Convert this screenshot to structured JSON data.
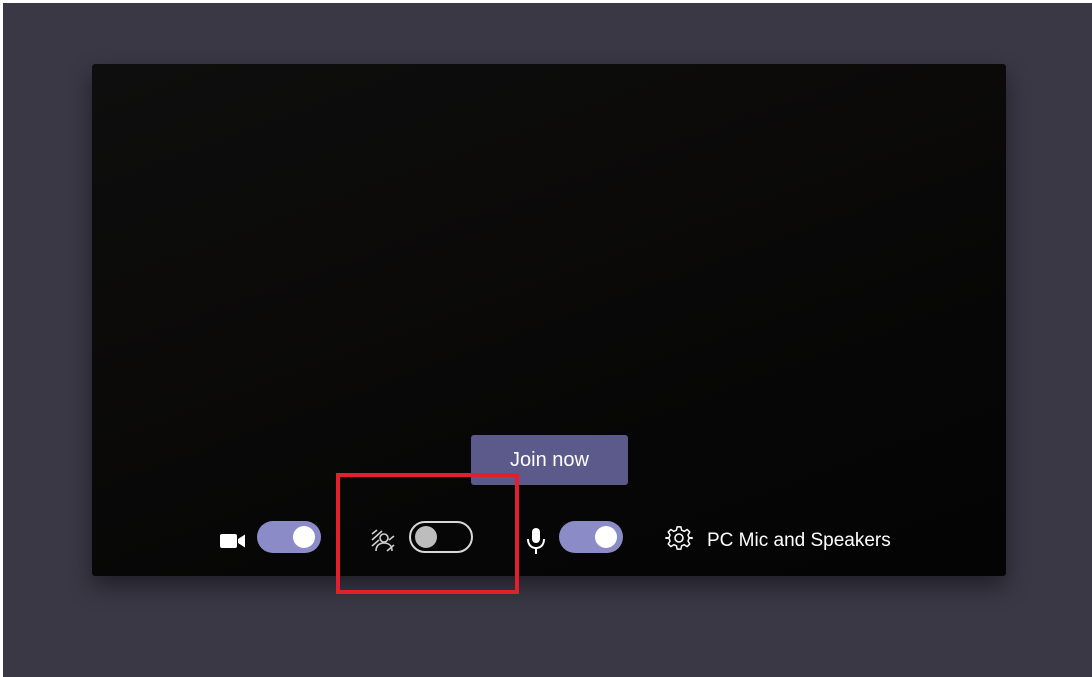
{
  "join_button": {
    "label": "Join now"
  },
  "controls": {
    "camera": {
      "icon": "camera-icon",
      "toggle_state": "on"
    },
    "background_blur": {
      "icon": "background-blur-icon",
      "toggle_state": "off"
    },
    "microphone": {
      "icon": "microphone-icon",
      "toggle_state": "on"
    },
    "device_settings": {
      "icon": "gear-icon",
      "label": "PC Mic and Speakers"
    }
  },
  "colors": {
    "page_background": "#3a3845",
    "preview_background": "#0b0a09",
    "accent": "#8b8cc7",
    "join_button": "#5b5a8a",
    "highlight": "#e0202a"
  }
}
